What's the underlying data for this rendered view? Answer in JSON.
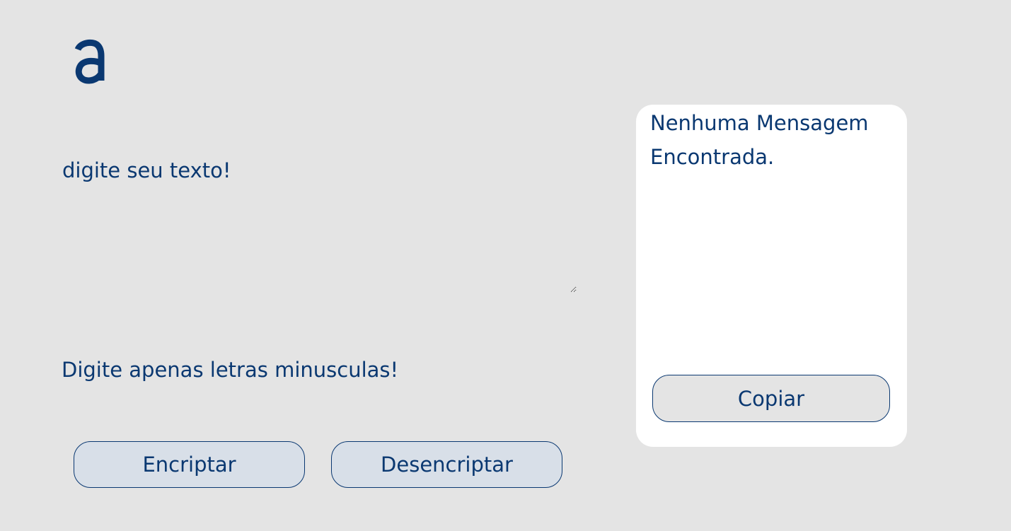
{
  "logo": {
    "icon": "alura-logo-icon",
    "color": "#0a3871"
  },
  "input": {
    "placeholder": "digite seu texto!",
    "value": ""
  },
  "hint": {
    "text": "Digite apenas letras minusculas!"
  },
  "actions": {
    "encrypt_label": "Encriptar",
    "decrypt_label": "Desencriptar"
  },
  "output": {
    "placeholder": "Nenhuma Mensagem Encontrada.",
    "value": "",
    "copy_label": "Copiar"
  },
  "colors": {
    "background": "#e4e4e4",
    "accent": "#0a3871",
    "button_bg": "#d8dfe8",
    "card_bg": "#ffffff"
  }
}
